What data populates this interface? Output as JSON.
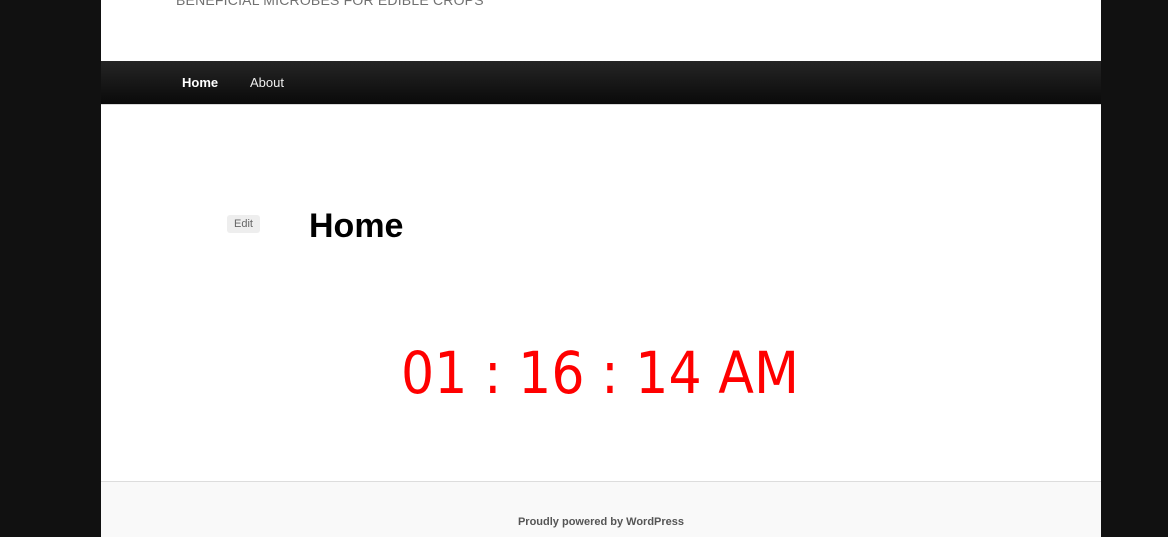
{
  "header": {
    "tagline": "BENEFICIAL MICROBES FOR EDIBLE CROPS"
  },
  "nav": {
    "items": [
      {
        "label": "Home"
      },
      {
        "label": "About"
      }
    ]
  },
  "main": {
    "edit_label": "Edit",
    "title": "Home",
    "clock": {
      "text": "01 : 16 : 14 AM",
      "color": "#ff0000"
    }
  },
  "footer": {
    "credit": "Proudly powered by WordPress"
  },
  "colors": {
    "nav_background": "#111111",
    "page_background": "#ffffff",
    "outer_background": "#111111",
    "footer_background": "#f9f9f9"
  }
}
